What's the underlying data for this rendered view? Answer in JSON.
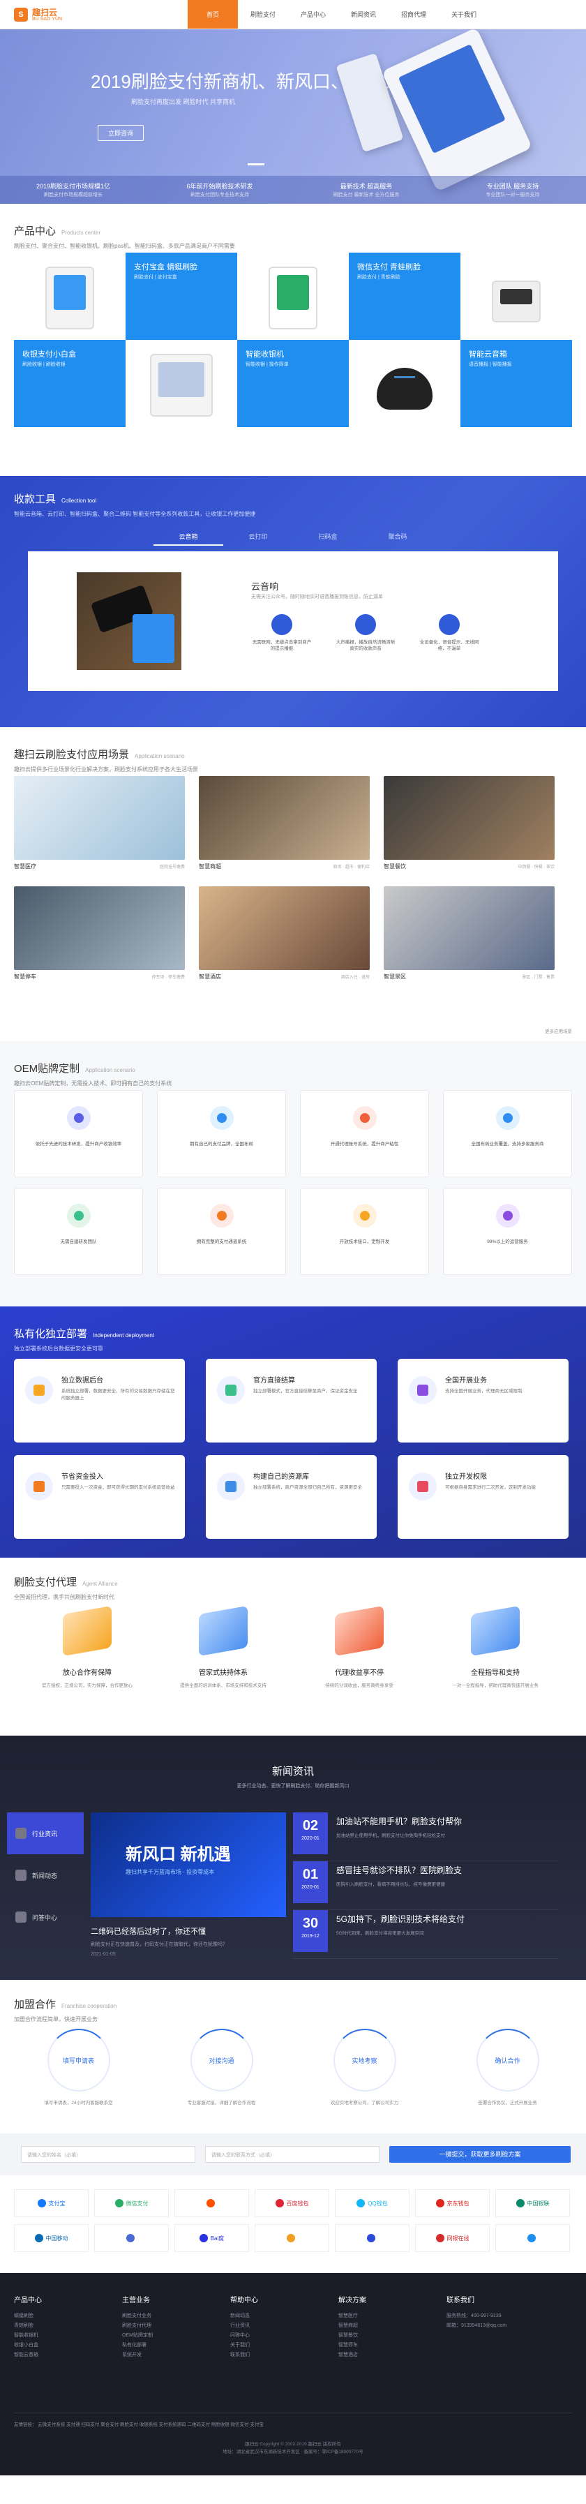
{
  "header": {
    "logo_name": "趣扫云",
    "logo_sub": "BU SAO YUN",
    "nav": [
      "首页",
      "刷脸支付",
      "产品中心",
      "新闻资讯",
      "招商代理",
      "关于我们"
    ]
  },
  "hero": {
    "title": "2019刷脸支付新商机、新风口、新机遇",
    "subtitle": "刷脸支付再度出发  刷脸时代 共享商机",
    "button": "立即咨询",
    "stats": [
      {
        "t": "2019刷脸支付市场规模1亿",
        "s": "刷脸支付市场规模超前增长"
      },
      {
        "t": "6年前开始刷脸技术研发",
        "s": "刷脸支付团队专业技术支持"
      },
      {
        "t": "最新技术 超高服务",
        "s": "刷脸支付 最新技术 全方位服务"
      },
      {
        "t": "专业团队 服务支持",
        "s": "专业团队一对一服务支持"
      }
    ]
  },
  "products": {
    "title": "产品中心",
    "en": "Products center",
    "desc": "刷脸支付、聚合支付、智能收银机、刷脸pos机、智能扫码盒、多款产品满足商户不同需要",
    "items": [
      {
        "n": "支付宝盒 蜻蜓刷脸",
        "s": "刷脸支付 | 支付宝盒",
        "blue": true
      },
      {
        "n": "",
        "s": "",
        "blue": false
      },
      {
        "n": "微信支付 青蛙刷脸",
        "s": "刷脸支付 | 青蛙刷脸",
        "blue": true
      },
      {
        "n": "",
        "s": "",
        "blue": false
      },
      {
        "n": "",
        "s": "",
        "blue": false
      },
      {
        "n": "收银支付小白盒",
        "s": "刷脸收银 | 刷脸收银",
        "blue": true
      },
      {
        "n": "",
        "s": "",
        "blue": false
      },
      {
        "n": "智能收银机",
        "s": "智能收银 | 操作简单",
        "blue": true
      },
      {
        "n": "",
        "s": "",
        "blue": false
      },
      {
        "n": "智能云音箱",
        "s": "语音播报 | 智能播报",
        "blue": true
      }
    ]
  },
  "tools": {
    "title": "收款工具",
    "en": "Collection tool",
    "desc": "智能云音箱、云打印、智能扫码盒、聚合二维码 智能支付等全系列收款工具，让收银工作更加便捷",
    "tabs": [
      "云音箱",
      "云打印",
      "扫码盒",
      "聚合码"
    ],
    "card_title": "云音响",
    "card_desc": "无需关注公众号，随时随地实时语音播报到账信息，防止漏单",
    "feats": [
      {
        "t": "无需联网，无缝点击拿到商户的提示播报"
      },
      {
        "t": "大声播报，播放自然流畅清晰真实的收款声音"
      },
      {
        "t": "全设备化，语音提示，无线网络，不漏单"
      }
    ]
  },
  "scenes": {
    "title": "趣扫云刷脸支付应用场景",
    "en": "Application scenario",
    "desc": "趣扫云提供多行业场景化行业解决方案，刷脸支付系统应用于各大生活场景",
    "items": [
      {
        "n": "智慧医疗",
        "r": "医院挂号缴费"
      },
      {
        "n": "智慧商超",
        "r": "商场 · 超市 · 便利店"
      },
      {
        "n": "智慧餐饮",
        "r": "中西餐 · 快餐 · 茶饮"
      },
      {
        "n": "智慧停车",
        "r": "停车场 · 停车缴费"
      },
      {
        "n": "智慧酒店",
        "r": "酒店入住 · 退房"
      },
      {
        "n": "智慧景区",
        "r": "景区 · 门票 · 售票"
      }
    ],
    "more": "更多应用场景"
  },
  "oem": {
    "title": "OEM贴牌定制",
    "en": "Application scenario",
    "desc": "趣扫云OEM贴牌定制，无需投入技术、即可拥有自己的支付系统",
    "items": [
      "依托于先进的技术研发，提升商户收银效率",
      "拥有自己的支付品牌，全国布局",
      "开通代理账号系统，提升商户粘性",
      "全国布局业务覆盖，支持多家服务商",
      "无需自建研发团队",
      "拥有完整的支付通道系统",
      "开放技术接口，定制开发",
      "99%以上的运营服务"
    ]
  },
  "deploy": {
    "title": "私有化独立部署",
    "en": "Independent deployment",
    "desc": "独立部署系统后台数据更安全更可靠",
    "items": [
      {
        "n": "独立数据后台",
        "d": "系统独立部署，数据更安全，所有的交易数据只存储在您的服务器上",
        "c": "#f6a623"
      },
      {
        "n": "官方直接结算",
        "d": "独立部署模式，官方直接结算至商户，保证资金安全",
        "c": "#3cc08a"
      },
      {
        "n": "全国开展业务",
        "d": "支持全国开展业务，代理商无区域限制",
        "c": "#8a4de0"
      },
      {
        "n": "节省资金投入",
        "d": "只需要投入一次资金，即可获得长期的支付系统运营收益",
        "c": "#f27b22"
      },
      {
        "n": "构建自己的资源库",
        "d": "独立部署系统，商户资源全部归自己所有，资源更安全",
        "c": "#3b8de8"
      },
      {
        "n": "独立开发权限",
        "d": "可根据自身需求进行二次开发，定制开发功能",
        "c": "#e84a5f"
      }
    ]
  },
  "agent": {
    "title": "刷脸支付代理",
    "en": "Agent Alliance",
    "desc": "全国诚招代理，携手共创刷脸支付新时代",
    "items": [
      {
        "n": "放心合作有保障",
        "d": "官方授权，正规公司，实力保障，合作更放心"
      },
      {
        "n": "管家式扶持体系",
        "d": "提供全面的培训体系、市场支持和技术支持"
      },
      {
        "n": "代理收益享不停",
        "d": "持续的分润收益，服务商终身享受"
      },
      {
        "n": "全程指导和支持",
        "d": "一对一全程指导，帮助代理商快速开展业务"
      }
    ]
  },
  "news": {
    "title": "新闻资讯",
    "desc": "更多行业动态、更快了解刷脸支付、助你把握新风口",
    "tabs": [
      "行业资讯",
      "新闻动态",
      "问答中心"
    ],
    "main_img_t1": "新风口 新机遇",
    "main_img_t2": "趣扫共享千万蓝海市场 · 投资零成本",
    "main_title": "二维码已经落后过时了，你还不懂",
    "main_sub": "刷脸支付正在快速普及，扫码支付正在被取代，你还在犹豫吗？",
    "main_date": "2021-01-05",
    "list": [
      {
        "d": "02",
        "m": "2020-01",
        "t": "加油站不能用手机？刷脸支付帮你",
        "s": "加油站禁止使用手机，刷脸支付让你免掏手机轻松支付"
      },
      {
        "d": "01",
        "m": "2020-01",
        "t": "感冒挂号就诊不排队？医院刷脸支",
        "s": "医院引入刷脸支付，看病不用排长队，挂号缴费更便捷"
      },
      {
        "d": "30",
        "m": "2019-12",
        "t": "5G加持下，刷脸识别技术将给支付",
        "s": "5G时代到来，刷脸支付将迎来更大发展空间"
      }
    ]
  },
  "join": {
    "title": "加盟合作",
    "en": "Franchise cooperation",
    "desc": "加盟合作流程简单，快速开展业务",
    "steps": [
      {
        "n": "填写申请表",
        "d": "填写申请表，24小时内客服联系您"
      },
      {
        "n": "对接沟通",
        "d": "专业客服对接，详细了解合作流程"
      },
      {
        "n": "实地考察",
        "d": "欢迎实地考察公司，了解公司实力"
      },
      {
        "n": "确认合作",
        "d": "签署合作协议，正式开展业务"
      }
    ]
  },
  "form": {
    "p1": "请输入您的姓名（必填）",
    "p2": "请输入您的联系方式（必填）",
    "btn": "一键提交，获取更多刷脸方案"
  },
  "partners": {
    "items": [
      {
        "n": "支付宝",
        "c": "#1677ff"
      },
      {
        "n": "微信支付",
        "c": "#2aae67"
      },
      {
        "n": "",
        "c": "#ff5000"
      },
      {
        "n": "百度钱包",
        "c": "#e02433"
      },
      {
        "n": "QQ钱包",
        "c": "#12b7f5"
      },
      {
        "n": "京东钱包",
        "c": "#e1251b"
      },
      {
        "n": "中国银联",
        "c": "#0a8a6a"
      },
      {
        "n": "中国移动",
        "c": "#0a6ab4"
      },
      {
        "n": "",
        "c": "#4a6bd6"
      },
      {
        "n": "Bai度",
        "c": "#2932e1"
      },
      {
        "n": "",
        "c": "#f0a020"
      },
      {
        "n": "",
        "c": "#2b4ad6"
      },
      {
        "n": "网银在线",
        "c": "#d62b2b"
      },
      {
        "n": "",
        "c": "#1f8ef0"
      }
    ]
  },
  "footer": {
    "cols": [
      {
        "t": "产品中心",
        "i": [
          "蜻蜓刷脸",
          "青蛙刷脸",
          "智能收银机",
          "收银小白盒",
          "智能云音箱"
        ]
      },
      {
        "t": "主营业务",
        "i": [
          "刷脸支付业务",
          "刷脸支付代理",
          "OEM贴牌定制",
          "私有化部署",
          "系统开发"
        ]
      },
      {
        "t": "帮助中心",
        "i": [
          "新闻动态",
          "行业资讯",
          "问答中心",
          "关于我们",
          "联系我们"
        ]
      },
      {
        "t": "解决方案",
        "i": [
          "智慧医疗",
          "智慧商超",
          "智慧餐饮",
          "智慧停车",
          "智慧酒店"
        ]
      },
      {
        "t": "联系我们",
        "i": [
          "服务热线：400-997-9139",
          "邮箱：913994813@qq.com"
        ]
      }
    ],
    "links": "友情链接：   云微支付系统   支付通   扫码支付   聚合支付   刷脸支付   收银系统   支付系统源码   二维码支付   刷脸收银   微信支付   支付宝",
    "copy1": "趣扫云  Copyright © 2002-2019 趣扫云 版权所有",
    "copy2": "地址：湖北省武汉市东湖新技术开发区 · 备案号：鄂ICP备18000770号"
  }
}
